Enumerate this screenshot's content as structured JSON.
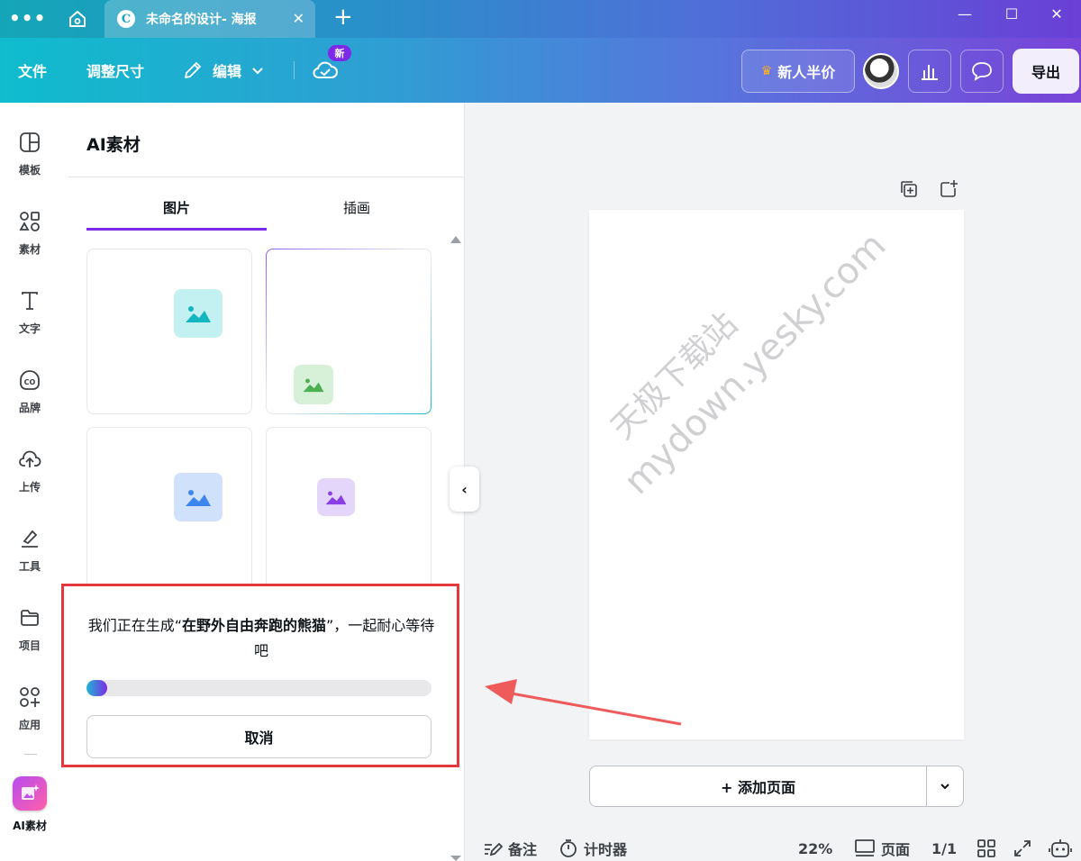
{
  "titlebar": {
    "menu_glyph": "•••",
    "tab_title": "未命名的设计- 海报",
    "close_glyph": "✕",
    "new_tab_glyph": "+",
    "minimize_glyph": "—",
    "maximize_glyph": "☐",
    "window_close_glyph": "✕",
    "logo_letter": "C"
  },
  "toolbar": {
    "file": "文件",
    "resize": "调整尺寸",
    "edit": "编辑",
    "new_badge": "新",
    "promo": "新人半价",
    "export": "导出",
    "crown_glyph": "♛"
  },
  "rail": {
    "items": [
      {
        "label": "模板",
        "icon": "template-icon"
      },
      {
        "label": "素材",
        "icon": "elements-icon"
      },
      {
        "label": "文字",
        "icon": "text-icon"
      },
      {
        "label": "品牌",
        "icon": "brand-icon"
      },
      {
        "label": "上传",
        "icon": "upload-icon"
      },
      {
        "label": "工具",
        "icon": "tools-icon"
      },
      {
        "label": "项目",
        "icon": "folder-icon"
      },
      {
        "label": "应用",
        "icon": "apps-icon"
      },
      {
        "label": "AI素材",
        "icon": "ai-magic-icon"
      }
    ]
  },
  "panel": {
    "title": "AI素材",
    "tabs": [
      "图片",
      "插画"
    ],
    "active_tab": 0,
    "generating": {
      "prefix": "我们正在生成“",
      "subject": "在野外自由奔跑的熊猫",
      "suffix": "”，一起耐心等待吧",
      "progress": 0.06,
      "cancel": "取消"
    },
    "collapse_glyph": "‹"
  },
  "canvas": {
    "watermark_line1": "天极下载站",
    "watermark_line2": "mydown.yesky.com",
    "add_page": "+ 添加页面"
  },
  "bottom": {
    "notes": "备注",
    "timer": "计时器",
    "zoom": "22%",
    "pages": "页面",
    "page_count": "1/1"
  },
  "colors": {
    "accent": "#7d2ae8",
    "highlight_border": "#e4393c",
    "arrow": "#ef5a5a"
  }
}
